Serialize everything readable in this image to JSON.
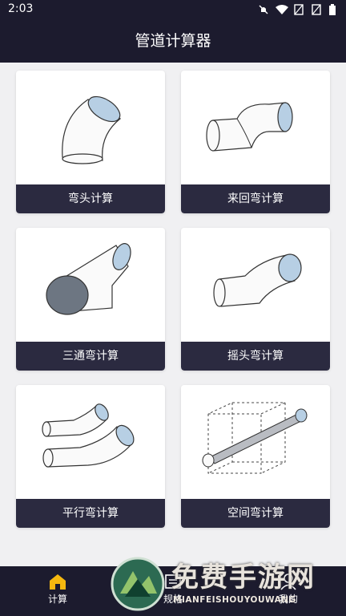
{
  "status_bar": {
    "time": "2:03",
    "icons": [
      "mute-icon",
      "wifi-icon",
      "sim-off-icon",
      "sim-off-icon",
      "battery-icon"
    ]
  },
  "app_bar": {
    "title": "管道计算器"
  },
  "cards": [
    {
      "label": "弯头计算"
    },
    {
      "label": "来回弯计算"
    },
    {
      "label": "三通弯计算"
    },
    {
      "label": "摇头弯计算"
    },
    {
      "label": "平行弯计算"
    },
    {
      "label": "空间弯计算"
    }
  ],
  "tabbar": {
    "tabs": [
      {
        "label": "计算",
        "icon": "home-icon",
        "active": true
      },
      {
        "label": "规格",
        "icon": "spec-icon",
        "active": false
      },
      {
        "label": "我的",
        "icon": "user-icon",
        "active": false
      }
    ]
  },
  "watermark": {
    "title": "免费手游网",
    "subtitle": "MIANFEISHOUYOUWANG"
  },
  "colors": {
    "bar_bg": "#1c1b2e",
    "card_label_bg": "#2b2a40",
    "active_tab": "#f5b80f",
    "pipe_end": "#a9c7df"
  }
}
